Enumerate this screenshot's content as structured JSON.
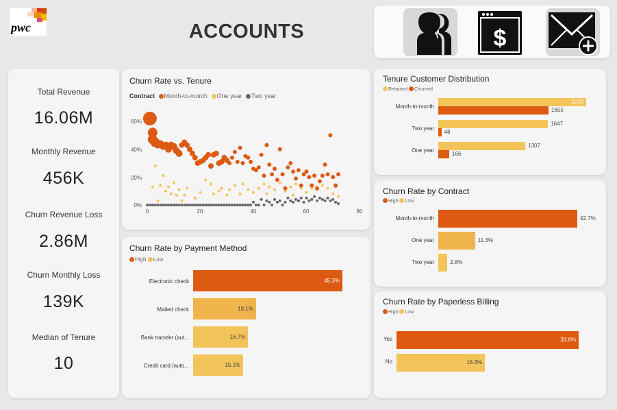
{
  "header": {
    "logo_text": "pwc",
    "page_title": "ACCOUNTS",
    "nav_icons": [
      "customer-profile-icon",
      "billing-icon",
      "email-icon"
    ]
  },
  "kpis": [
    {
      "label": "Total Revenue",
      "value": "16.06M"
    },
    {
      "label": "Monthly Revenue",
      "value": "456K"
    },
    {
      "label": "Churn Revenue Loss",
      "value": "2.86M"
    },
    {
      "label": "Churn Monthly Loss",
      "value": "139K"
    },
    {
      "label": "Median of Tenure",
      "value": "10"
    }
  ],
  "colors": {
    "month_to_month": "#dd5a12",
    "one_year": "#f2c45a",
    "two_year": "#666666",
    "high": "#dd5a12",
    "low": "#f2c45a",
    "mid": "#efb44c"
  },
  "charts": {
    "churn_tenure": {
      "title": "Churn Rate vs. Tenure",
      "legend_title": "Contract",
      "legend_items": [
        "Month-to-month",
        "One year",
        "Two year"
      ],
      "x_ticks": [
        "0",
        "20",
        "40",
        "60",
        "80"
      ],
      "y_ticks": [
        "0%",
        "20%",
        "40%",
        "60%"
      ]
    },
    "payment": {
      "title": "Churn Rate by Payment Method",
      "legend_items": [
        "High",
        "Low"
      ],
      "categories": [
        "Electronic check",
        "Mailed check",
        "Bank transfer (aut...",
        "Credit card (auto..."
      ],
      "labels": [
        "45.3%",
        "19.1%",
        "16.7%",
        "15.2%"
      ]
    },
    "tenure_dist": {
      "title": "Tenure Customer Distribution",
      "legend_items": [
        "Retained",
        "Churned"
      ],
      "categories": [
        "Month-to-month",
        "Two year",
        "One year"
      ],
      "retained_labels": [
        "2220",
        "1647",
        "1307"
      ],
      "churned_labels": [
        "1655",
        "48",
        "166"
      ]
    },
    "contract": {
      "title": "Churn Rate by Contract",
      "legend_items": [
        "High",
        "Low"
      ],
      "categories": [
        "Month-to-month",
        "One year",
        "Two year"
      ],
      "labels": [
        "42.7%",
        "11.3%",
        "2.8%"
      ]
    },
    "paperless": {
      "title": "Churn Rate by Paperless Billing",
      "legend_items": [
        "High",
        "Low"
      ],
      "categories": [
        "Yes",
        "No"
      ],
      "labels": [
        "33.6%",
        "16.3%"
      ]
    }
  },
  "chart_data": [
    {
      "type": "scatter",
      "title": "Churn Rate vs. Tenure",
      "legend": [
        "Month-to-month",
        "One year",
        "Two year"
      ],
      "xlim": [
        0,
        80
      ],
      "ylim": [
        0,
        0.6
      ],
      "grid": false,
      "series": [
        {
          "name": "Month-to-month",
          "points": [
            [
              1,
              0.62
            ],
            [
              2,
              0.52
            ],
            [
              2,
              0.47
            ],
            [
              3,
              0.45
            ],
            [
              4,
              0.43
            ],
            [
              5,
              0.44
            ],
            [
              6,
              0.42
            ],
            [
              7,
              0.43
            ],
            [
              8,
              0.4
            ],
            [
              9,
              0.43
            ],
            [
              10,
              0.42
            ],
            [
              11,
              0.39
            ],
            [
              12,
              0.37
            ],
            [
              13,
              0.43
            ],
            [
              14,
              0.45
            ],
            [
              15,
              0.43
            ],
            [
              16,
              0.4
            ],
            [
              17,
              0.37
            ],
            [
              18,
              0.34
            ],
            [
              19,
              0.3
            ],
            [
              20,
              0.31
            ],
            [
              21,
              0.32
            ],
            [
              22,
              0.34
            ],
            [
              23,
              0.36
            ],
            [
              24,
              0.28
            ],
            [
              25,
              0.36
            ],
            [
              26,
              0.37
            ],
            [
              27,
              0.3
            ],
            [
              28,
              0.31
            ],
            [
              29,
              0.34
            ],
            [
              30,
              0.32
            ],
            [
              31,
              0.3
            ],
            [
              32,
              0.34
            ],
            [
              33,
              0.38
            ],
            [
              34,
              0.31
            ],
            [
              35,
              0.41
            ],
            [
              36,
              0.3
            ],
            [
              37,
              0.35
            ],
            [
              38,
              0.34
            ],
            [
              39,
              0.31
            ],
            [
              40,
              0.26
            ],
            [
              41,
              0.25
            ],
            [
              42,
              0.27
            ],
            [
              43,
              0.36
            ],
            [
              44,
              0.21
            ],
            [
              45,
              0.43
            ],
            [
              46,
              0.29
            ],
            [
              47,
              0.22
            ],
            [
              48,
              0.26
            ],
            [
              49,
              0.18
            ],
            [
              50,
              0.4
            ],
            [
              51,
              0.22
            ],
            [
              52,
              0.12
            ],
            [
              53,
              0.27
            ],
            [
              54,
              0.3
            ],
            [
              55,
              0.24
            ],
            [
              56,
              0.19
            ],
            [
              57,
              0.25
            ],
            [
              58,
              0.14
            ],
            [
              59,
              0.22
            ],
            [
              60,
              0.24
            ],
            [
              61,
              0.2
            ],
            [
              62,
              0.14
            ],
            [
              63,
              0.21
            ],
            [
              64,
              0.12
            ],
            [
              65,
              0.17
            ],
            [
              66,
              0.21
            ],
            [
              67,
              0.29
            ],
            [
              68,
              0.22
            ],
            [
              69,
              0.5
            ],
            [
              70,
              0.2
            ],
            [
              71,
              0.14
            ],
            [
              72,
              0.22
            ]
          ]
        },
        {
          "name": "One year",
          "points": [
            [
              2,
              0.13
            ],
            [
              3,
              0.28
            ],
            [
              4,
              0.03
            ],
            [
              5,
              0.14
            ],
            [
              6,
              0.21
            ],
            [
              7,
              0.1
            ],
            [
              8,
              0.13
            ],
            [
              9,
              0.08
            ],
            [
              10,
              0.16
            ],
            [
              11,
              0.07
            ],
            [
              12,
              0.11
            ],
            [
              13,
              0.03
            ],
            [
              14,
              0.07
            ],
            [
              15,
              0.12
            ],
            [
              18,
              0.05
            ],
            [
              20,
              0.09
            ],
            [
              22,
              0.18
            ],
            [
              24,
              0.15
            ],
            [
              25,
              0.08
            ],
            [
              27,
              0.1
            ],
            [
              28,
              0.12
            ],
            [
              30,
              0.07
            ],
            [
              31,
              0.11
            ],
            [
              33,
              0.14
            ],
            [
              35,
              0.08
            ],
            [
              36,
              0.15
            ],
            [
              38,
              0.11
            ],
            [
              40,
              0.09
            ],
            [
              42,
              0.12
            ],
            [
              44,
              0.15
            ],
            [
              45,
              0.08
            ],
            [
              46,
              0.13
            ],
            [
              48,
              0.11
            ],
            [
              50,
              0.16
            ],
            [
              52,
              0.1
            ],
            [
              54,
              0.13
            ],
            [
              55,
              0.07
            ],
            [
              56,
              0.15
            ],
            [
              58,
              0.12
            ],
            [
              60,
              0.09
            ],
            [
              62,
              0.12
            ],
            [
              64,
              0.11
            ],
            [
              66,
              0.14
            ],
            [
              68,
              0.12
            ],
            [
              70,
              0.08
            ],
            [
              71,
              0.13
            ],
            [
              72,
              0.06
            ]
          ]
        },
        {
          "name": "Two year",
          "points": [
            [
              0,
              0
            ],
            [
              1,
              0
            ],
            [
              2,
              0
            ],
            [
              3,
              0
            ],
            [
              4,
              0
            ],
            [
              5,
              0
            ],
            [
              6,
              0
            ],
            [
              7,
              0
            ],
            [
              8,
              0
            ],
            [
              9,
              0
            ],
            [
              10,
              0
            ],
            [
              11,
              0
            ],
            [
              12,
              0
            ],
            [
              13,
              0
            ],
            [
              14,
              0
            ],
            [
              15,
              0
            ],
            [
              16,
              0
            ],
            [
              17,
              0
            ],
            [
              18,
              0
            ],
            [
              19,
              0
            ],
            [
              20,
              0
            ],
            [
              21,
              0
            ],
            [
              22,
              0
            ],
            [
              23,
              0
            ],
            [
              24,
              0
            ],
            [
              25,
              0
            ],
            [
              26,
              0
            ],
            [
              27,
              0
            ],
            [
              28,
              0
            ],
            [
              29,
              0
            ],
            [
              30,
              0
            ],
            [
              31,
              0
            ],
            [
              32,
              0
            ],
            [
              33,
              0
            ],
            [
              34,
              0
            ],
            [
              35,
              0
            ],
            [
              36,
              0
            ],
            [
              37,
              0
            ],
            [
              38,
              0
            ],
            [
              39,
              0
            ],
            [
              40,
              0.02
            ],
            [
              41,
              0
            ],
            [
              42,
              0
            ],
            [
              43,
              0.04
            ],
            [
              44,
              0
            ],
            [
              45,
              0.03
            ],
            [
              46,
              0.02
            ],
            [
              47,
              0
            ],
            [
              48,
              0.04
            ],
            [
              49,
              0.02
            ],
            [
              50,
              0.03
            ],
            [
              51,
              0
            ],
            [
              52,
              0.02
            ],
            [
              53,
              0.05
            ],
            [
              54,
              0.03
            ],
            [
              55,
              0.02
            ],
            [
              56,
              0.04
            ],
            [
              57,
              0.03
            ],
            [
              58,
              0.05
            ],
            [
              59,
              0.02
            ],
            [
              60,
              0.05
            ],
            [
              61,
              0.03
            ],
            [
              62,
              0.04
            ],
            [
              63,
              0.06
            ],
            [
              64,
              0.03
            ],
            [
              65,
              0.05
            ],
            [
              66,
              0.04
            ],
            [
              67,
              0.03
            ],
            [
              68,
              0.05
            ],
            [
              69,
              0.03
            ],
            [
              70,
              0.04
            ],
            [
              71,
              0.02
            ],
            [
              72,
              0.01
            ]
          ]
        }
      ]
    },
    {
      "type": "bar",
      "title": "Churn Rate by Payment Method",
      "orientation": "horizontal",
      "categories": [
        "Electronic check",
        "Mailed check",
        "Bank transfer (aut...",
        "Credit card (auto..."
      ],
      "values": [
        45.3,
        19.1,
        16.7,
        15.2
      ],
      "unit": "%"
    },
    {
      "type": "bar",
      "title": "Tenure Customer Distribution",
      "orientation": "horizontal",
      "categories": [
        "Month-to-month",
        "Two year",
        "One year"
      ],
      "series": [
        {
          "name": "Retained",
          "values": [
            2220,
            1647,
            1307
          ]
        },
        {
          "name": "Churned",
          "values": [
            1655,
            48,
            166
          ]
        }
      ]
    },
    {
      "type": "bar",
      "title": "Churn Rate by Contract",
      "orientation": "horizontal",
      "categories": [
        "Month-to-month",
        "One year",
        "Two year"
      ],
      "values": [
        42.7,
        11.3,
        2.8
      ],
      "unit": "%"
    },
    {
      "type": "bar",
      "title": "Churn Rate by Paperless Billing",
      "orientation": "horizontal",
      "categories": [
        "Yes",
        "No"
      ],
      "values": [
        33.6,
        16.3
      ],
      "unit": "%"
    }
  ]
}
